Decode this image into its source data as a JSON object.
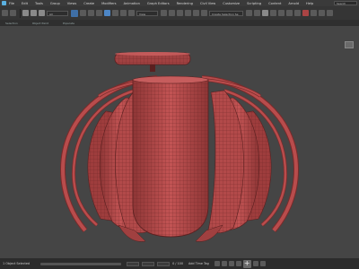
{
  "menubar": {
    "items": [
      "File",
      "Edit",
      "Tools",
      "Group",
      "Views",
      "Create",
      "Modifiers",
      "Animation",
      "Graph Editors",
      "Rendering",
      "Civil View",
      "Customize",
      "Scripting",
      "Content",
      "Arnold",
      "Help"
    ],
    "search_label": "Search"
  },
  "toolbar": {
    "selection_set_placeholder": "Create Selection Se",
    "view_dropdown": "View"
  },
  "viewport_tabs": [
    "Selection",
    "Object Paint",
    "Populate"
  ],
  "statusbar": {
    "status_text": "1 Object Selected",
    "frame_counter": "0 / 100",
    "add_time_tag": "Add Time Tag"
  },
  "colors": {
    "model": "#b84c4c",
    "model_dark": "#7a2b2b",
    "wire": "#5a1f1f",
    "viewport_bg": "#454545"
  }
}
